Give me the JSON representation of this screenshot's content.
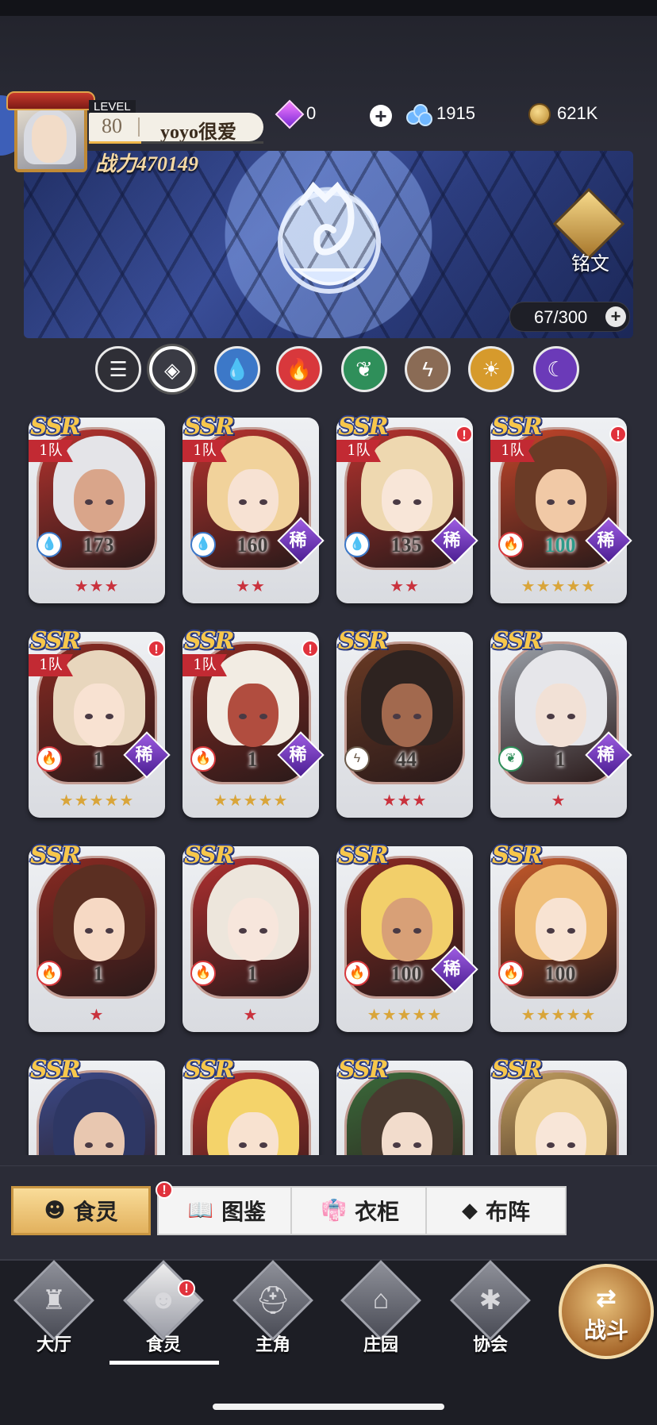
{
  "player": {
    "level_label": "LEVEL",
    "level": "80",
    "name": "yoyo很爱",
    "power": "战力470149",
    "xp_fraction": 0.3
  },
  "resources": {
    "gems": "0",
    "crystals": "1915",
    "coins": "621K"
  },
  "banner": {
    "rune_label": "铭文",
    "count": "67/300"
  },
  "filters": [
    {
      "id": "list",
      "symbol": "☰",
      "bg": "#2f2f36",
      "fg": "#ffffff"
    },
    {
      "id": "all",
      "symbol": "◈",
      "bg": "#3a3b44",
      "fg": "#ffffff"
    },
    {
      "id": "water",
      "symbol": "💧",
      "bg": "#3c78c8",
      "fg": "#ffffff"
    },
    {
      "id": "fire",
      "symbol": "🔥",
      "bg": "#d8383c",
      "fg": "#ffffff"
    },
    {
      "id": "wind",
      "symbol": "❦",
      "bg": "#2f8f5a",
      "fg": "#ffffff"
    },
    {
      "id": "thunder",
      "symbol": "ϟ",
      "bg": "#8a6b55",
      "fg": "#ffffff"
    },
    {
      "id": "light",
      "symbol": "☀",
      "bg": "#d69a2c",
      "fg": "#ffffff"
    },
    {
      "id": "dark",
      "symbol": "☾",
      "bg": "#6b3ab8",
      "fg": "#ffffff"
    }
  ],
  "cards": [
    {
      "rarity": "SSR",
      "team": "1队",
      "alert": false,
      "element": "water",
      "level": "173",
      "rare": false,
      "stars": "★★★",
      "gold": false,
      "hair": "#e4e4e8",
      "skin": "#d9a58a",
      "bg": "#b7332e"
    },
    {
      "rarity": "SSR",
      "team": "1队",
      "alert": false,
      "element": "water",
      "level": "160",
      "rare": true,
      "stars": "★★",
      "gold": false,
      "hair": "#f1d29b",
      "skin": "#f7e2d3",
      "bg": "#b7332e"
    },
    {
      "rarity": "SSR",
      "team": "1队",
      "alert": true,
      "element": "water",
      "level": "135",
      "rare": true,
      "stars": "★★",
      "gold": false,
      "hair": "#eed8b0",
      "skin": "#f8e6d8",
      "bg": "#b7332e"
    },
    {
      "rarity": "SSR",
      "team": "1队",
      "alert": true,
      "element": "fire",
      "level": "100",
      "rare": true,
      "stars": "★★★★★",
      "gold": true,
      "hair": "#6b3b26",
      "skin": "#f1c9a6",
      "bg": "#c4462a",
      "teal": true
    },
    {
      "rarity": "SSR",
      "team": "1队",
      "alert": true,
      "element": "fire",
      "level": "1",
      "rare": true,
      "stars": "★★★★★",
      "gold": true,
      "hair": "#e8d6bd",
      "skin": "#f8e2d2",
      "bg": "#8a2a22"
    },
    {
      "rarity": "SSR",
      "team": "1队",
      "alert": true,
      "element": "fire",
      "level": "1",
      "rare": true,
      "stars": "★★★★★",
      "gold": true,
      "hair": "#f2ece3",
      "skin": "#b14d3f",
      "bg": "#8a2a22"
    },
    {
      "rarity": "SSR",
      "team": "",
      "alert": false,
      "element": "thunder",
      "level": "44",
      "rare": false,
      "stars": "★★★",
      "gold": false,
      "hair": "#2e2320",
      "skin": "#a2694e",
      "bg": "#6a3a24"
    },
    {
      "rarity": "SSR",
      "team": "",
      "alert": false,
      "element": "wind",
      "level": "1",
      "rare": true,
      "stars": "★",
      "gold": false,
      "hair": "#e6e6ea",
      "skin": "#f2e1d6",
      "bg": "#9aa0a8"
    },
    {
      "rarity": "SSR",
      "team": "",
      "alert": false,
      "element": "fire",
      "level": "1",
      "rare": false,
      "stars": "★",
      "gold": false,
      "hair": "#5b2f22",
      "skin": "#f6d9c4",
      "bg": "#8a2a22"
    },
    {
      "rarity": "SSR",
      "team": "",
      "alert": false,
      "element": "fire",
      "level": "1",
      "rare": false,
      "stars": "★",
      "gold": false,
      "hair": "#ede6dc",
      "skin": "#f7e6dc",
      "bg": "#b03030"
    },
    {
      "rarity": "SSR",
      "team": "",
      "alert": false,
      "element": "fire",
      "level": "100",
      "rare": true,
      "stars": "★★★★★",
      "gold": true,
      "hair": "#f2cf6a",
      "skin": "#d8a077",
      "bg": "#8a2a22"
    },
    {
      "rarity": "SSR",
      "team": "",
      "alert": false,
      "element": "fire",
      "level": "100",
      "rare": false,
      "stars": "★★★★★",
      "gold": true,
      "hair": "#f0c07a",
      "skin": "#f8e3d2",
      "bg": "#c75a2a"
    },
    {
      "rarity": "SSR",
      "team": "",
      "alert": false,
      "element": "",
      "level": "",
      "rare": false,
      "stars": "",
      "gold": false,
      "hair": "#2e3764",
      "skin": "#e8c7b0",
      "bg": "#3b4a8a"
    },
    {
      "rarity": "SSR",
      "team": "",
      "alert": false,
      "element": "",
      "level": "",
      "rare": false,
      "stars": "",
      "gold": false,
      "hair": "#f4d36a",
      "skin": "#f8e2d0",
      "bg": "#b7332e"
    },
    {
      "rarity": "SSR",
      "team": "",
      "alert": false,
      "element": "",
      "level": "",
      "rare": false,
      "stars": "",
      "gold": false,
      "hair": "#4a3a30",
      "skin": "#f2dccc",
      "bg": "#3a6a3a"
    },
    {
      "rarity": "SSR",
      "team": "",
      "alert": false,
      "element": "",
      "level": "",
      "rare": false,
      "stars": "",
      "gold": false,
      "hair": "#f0d49a",
      "skin": "#f8e6d8",
      "bg": "#c4a060"
    }
  ],
  "element_colors": {
    "water": "#3c78c8",
    "fire": "#d8383c",
    "wind": "#2f8f5a",
    "thunder": "#6b5a4a"
  },
  "element_symbols": {
    "water": "💧",
    "fire": "🔥",
    "wind": "❦",
    "thunder": "ϟ"
  },
  "rare_label": "稀",
  "tabs": [
    {
      "label": "食灵",
      "icon": "☻",
      "active": true
    },
    {
      "label": "图鉴",
      "icon": "📖",
      "active": false
    },
    {
      "label": "衣柜",
      "icon": "👘",
      "active": false
    },
    {
      "label": "布阵",
      "icon": "◆",
      "active": false
    }
  ],
  "nav": [
    {
      "label": "大厅",
      "glyph": "♜"
    },
    {
      "label": "食灵",
      "glyph": "☻"
    },
    {
      "label": "主角",
      "glyph": "⛑"
    },
    {
      "label": "庄园",
      "glyph": "⌂"
    },
    {
      "label": "协会",
      "glyph": "✱"
    }
  ],
  "battle_label": "战斗",
  "alert_mark": "!"
}
